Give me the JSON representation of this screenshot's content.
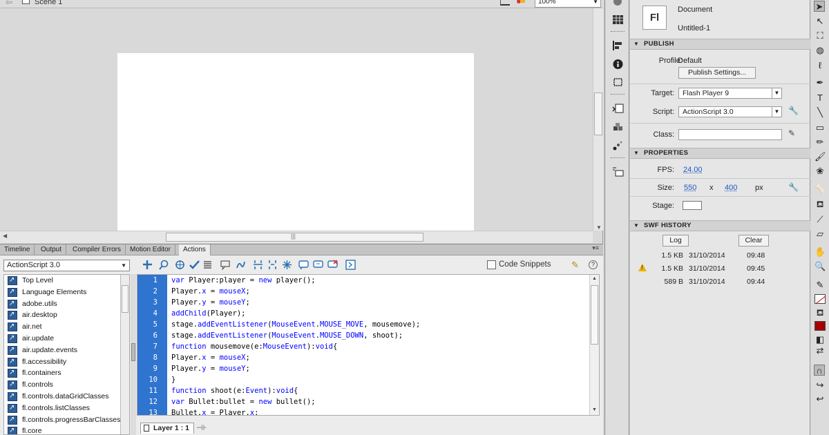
{
  "scene": {
    "label": "Scene 1",
    "zoom": "100%"
  },
  "panel_tabs": [
    "Timeline",
    "Output",
    "Compiler Errors",
    "Motion Editor",
    "Actions"
  ],
  "actions": {
    "version_select": "ActionScript 3.0",
    "toolbox_items": [
      "Top Level",
      "Language Elements",
      "adobe.utils",
      "air.desktop",
      "air.net",
      "air.update",
      "air.update.events",
      "fl.accessibility",
      "fl.containers",
      "fl.controls",
      "fl.controls.dataGridClasses",
      "fl.controls.listClasses",
      "fl.controls.progressBarClasses",
      "fl.core"
    ],
    "code_snippets_label": "Code Snippets",
    "layer_tab": "Layer 1 : 1",
    "line_numbers": [
      "1",
      "2",
      "3",
      "4",
      "5",
      "6",
      "7",
      "8",
      "9",
      "10",
      "11",
      "12",
      "13"
    ],
    "code_lines": [
      "var Player:player = new player();",
      "Player.x = mouseX;",
      "Player.y = mouseY;",
      "addChild(Player);",
      "stage.addEventListener(MouseEvent.MOUSE_MOVE, mousemove);",
      "stage.addEventListener(MouseEvent.MOUSE_DOWN, shoot);",
      "function mousemove(e:MouseEvent):void{",
      "Player.x = mouseX;",
      "Player.y = mouseY;",
      "}",
      "function shoot(e:Event):void{",
      "var Bullet:bullet = new bullet();",
      "Bullet.x = Player.x;"
    ]
  },
  "properties": {
    "doc_icon": "Fl",
    "doc_type": "Document",
    "doc_name": "Untitled-1",
    "publish_header": "PUBLISH",
    "profile_label": "Profile:",
    "profile_value": "Default",
    "publish_settings_button": "Publish Settings...",
    "target_label": "Target:",
    "target_value": "Flash Player 9",
    "script_label": "Script:",
    "script_value": "ActionScript 3.0",
    "class_label": "Class:",
    "class_value": "",
    "properties_header": "PROPERTIES",
    "fps_label": "FPS:",
    "fps_value": "24.00",
    "size_label": "Size:",
    "width_value": "550",
    "size_x": "x",
    "height_value": "400",
    "size_unit": "px",
    "stage_label": "Stage:",
    "stage_color": "#ffffff",
    "history_header": "SWF HISTORY",
    "log_button": "Log",
    "clear_button": "Clear",
    "history": [
      {
        "size": "1.5 KB",
        "date": "31/10/2014",
        "time": "09:48",
        "warning": false
      },
      {
        "size": "1.5 KB",
        "date": "31/10/2014",
        "time": "09:45",
        "warning": true
      },
      {
        "size": "589 B",
        "date": "31/10/2014",
        "time": "09:44",
        "warning": false
      }
    ]
  },
  "colors": {
    "gutter": "#2f74cf",
    "keyword": "#0000ff",
    "fill": "#a80000",
    "link": "#1e56c2"
  }
}
